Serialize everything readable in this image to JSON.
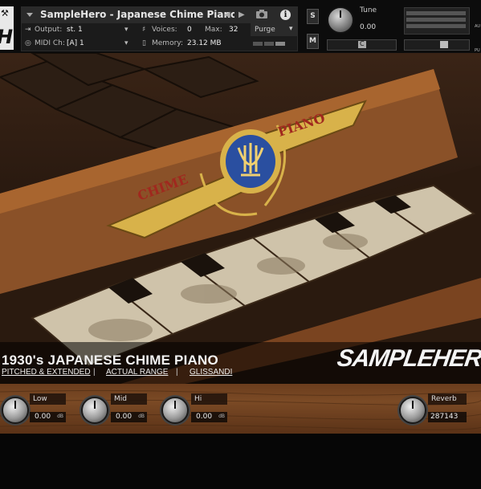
{
  "header": {
    "instrument_name": "SampleHero - Japanese Chime Piano",
    "output_label": "Output:",
    "output_value": "st. 1",
    "voices_label": "Voices:",
    "voices_value": "0",
    "max_label": "Max:",
    "max_value": "32",
    "purge_label": "Purge",
    "midi_label": "MIDI Ch:",
    "midi_value": "[A]  1",
    "memory_label": "Memory:",
    "memory_value": "23.12 MB",
    "solo_label": "S",
    "mute_label": "M",
    "tune_label": "Tune",
    "tune_value": "0.00",
    "pan_value": "C",
    "side_labels": [
      "AU",
      "PU"
    ]
  },
  "artwork": {
    "fallboard_text_left": "CHIME",
    "fallboard_text_right": "PIANO",
    "title": "1930's JAPANESE CHIME PIANO",
    "links": [
      "PITCHED & EXTENDED",
      "ACTUAL RANGE",
      "GLISSANDI"
    ],
    "separator": "|",
    "brand": "SAMPLEHERO"
  },
  "controls": {
    "low": {
      "label": "Low",
      "value": "0.00",
      "unit": "dB"
    },
    "mid": {
      "label": "Mid",
      "value": "0.00",
      "unit": "dB"
    },
    "hi": {
      "label": "Hi",
      "value": "0.00",
      "unit": "dB"
    },
    "reverb": {
      "label": "Reverb",
      "value": "287143"
    }
  },
  "colors": {
    "wood": "#7b4a25",
    "panel": "#1b1b1b",
    "banner": "#d8b24a",
    "medallion": "#2a4fa0"
  }
}
